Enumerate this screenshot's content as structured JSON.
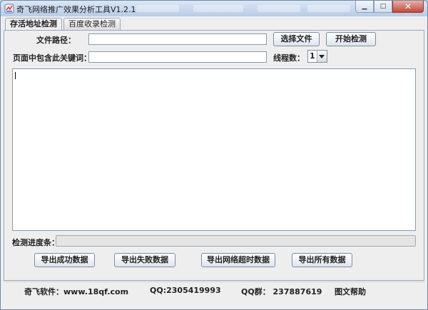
{
  "window": {
    "title": "奇飞网络推广效果分析工具V1.2.1",
    "buttons": {
      "minimize": "▁",
      "maximize": "□",
      "close": "✕"
    }
  },
  "tabs": [
    {
      "label": "存活地址检测",
      "active": true
    },
    {
      "label": "百度收录检测",
      "active": false
    }
  ],
  "form": {
    "file_path_label": "文件路径：",
    "file_path_value": "",
    "choose_file_button": "选择文件",
    "start_check_button": "开始检测",
    "keyword_label": "页面中包含此关键词：",
    "keyword_value": "",
    "threads_label": "线程数：",
    "threads_value": "1"
  },
  "progress": {
    "label": "检测进度条：",
    "value": 0
  },
  "export_buttons": {
    "success": "导出成功数据",
    "failed": "导出失败数据",
    "timeout": "导出网络超时数据",
    "all": "导出所有数据"
  },
  "footer": {
    "software": "奇飞软件：www.18qf.com",
    "qq": "QQ:2305419993",
    "qq_group": "QQ群： 237887619",
    "help": "图文帮助"
  },
  "colors": {
    "titlebar": "#c3d4e8",
    "panel_bg": "#eeeeee",
    "close_button": "#c5463a",
    "progress_fill": "#4a90d9"
  }
}
